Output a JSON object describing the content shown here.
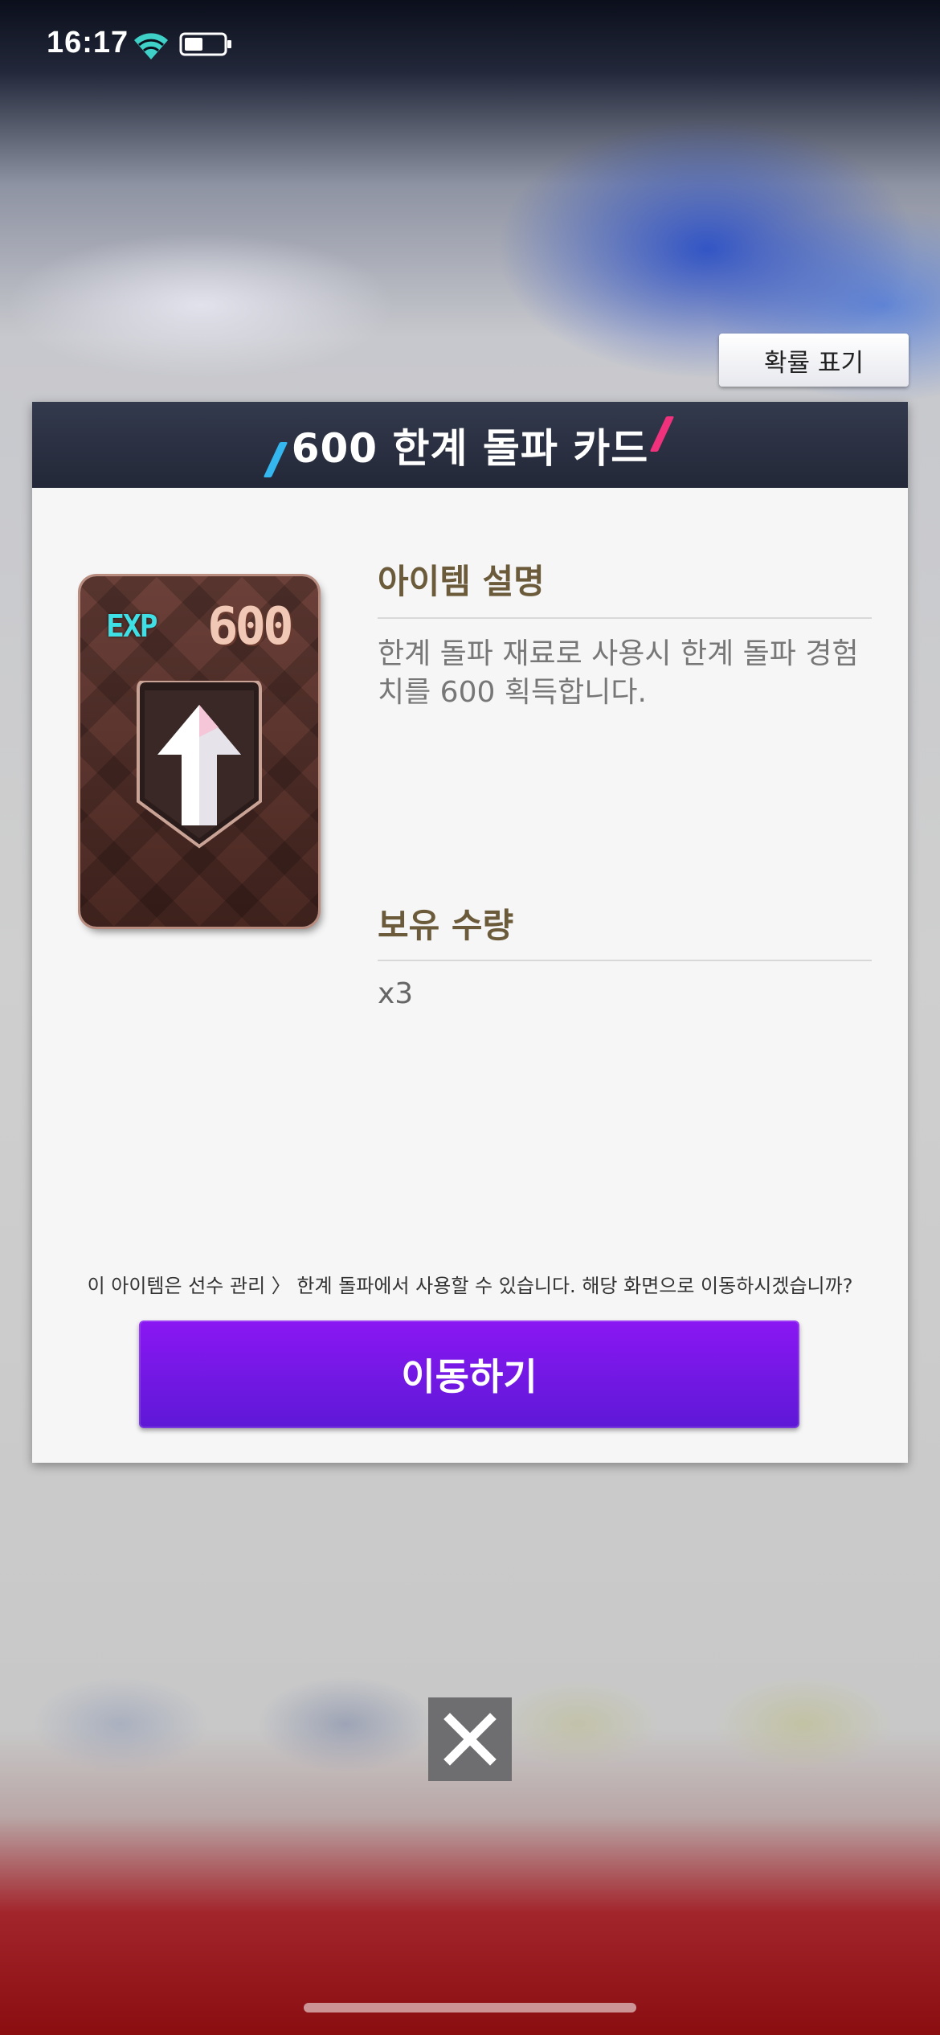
{
  "status_bar": {
    "time": "16:17",
    "icons": [
      "wifi-icon",
      "battery-icon"
    ]
  },
  "probability_button": {
    "label": "확률 표기"
  },
  "dialog": {
    "title": "600 한계 돌파 카드",
    "card": {
      "badge": "EXP",
      "value": "600",
      "icon": "up-arrow-icon"
    },
    "item_description": {
      "heading": "아이템 설명",
      "text": "한계 돌파 재료로 사용시 한계 돌파 경험치를 600 획득합니다."
    },
    "owned_quantity": {
      "heading": "보유 수량",
      "value": "x3"
    },
    "notice": "이 아이템은 선수 관리 〉 한계 돌파에서 사용할 수 있습니다. 해당 화면으로 이동하시겠습니까?",
    "move_button": {
      "label": "이동하기"
    }
  },
  "close_button": {
    "icon": "close-icon"
  },
  "colors": {
    "header": "#2b3042",
    "accent_left": "#34b6ee",
    "accent_right": "#f0327d",
    "button_primary": "#7417e8",
    "heading_text": "#6b5b3b"
  }
}
